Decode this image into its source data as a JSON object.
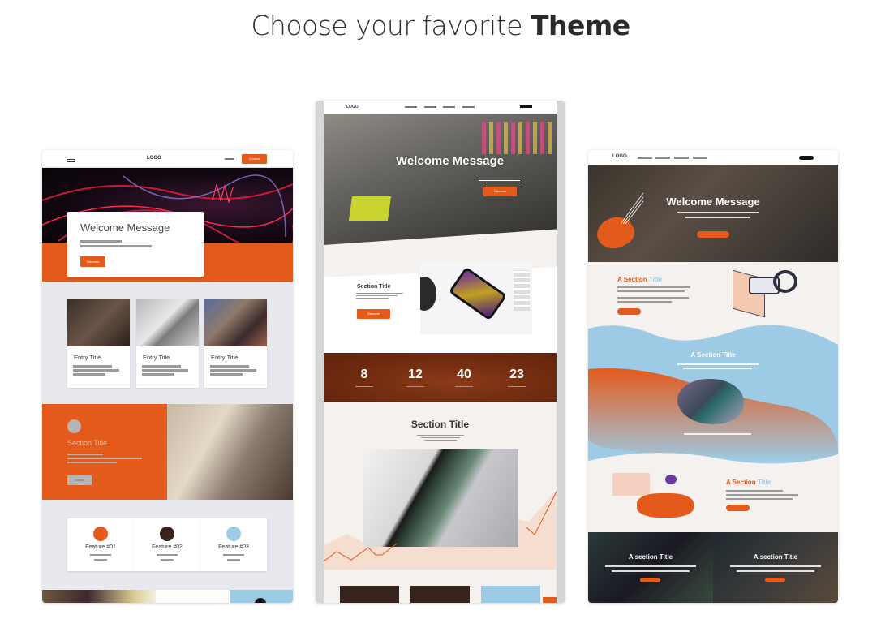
{
  "heading": {
    "prefix": "Choose your favorite ",
    "emphasis": "Theme"
  },
  "themes": [
    {
      "nav": {
        "logo": "LOGO",
        "cta": "Contact"
      },
      "hero": {
        "title": "Welcome Message",
        "button": "Discover"
      },
      "entries": [
        {
          "title": "Entry Title"
        },
        {
          "title": "Entry Title"
        },
        {
          "title": "Entry Title"
        }
      ],
      "section": {
        "title": "Section Title",
        "button": "Details"
      },
      "features": [
        {
          "label": "Feature #01",
          "color": "#e45a1b"
        },
        {
          "label": "Feature #02",
          "color": "#36231b"
        },
        {
          "label": "Feature #03",
          "color": "#9dcbe6"
        }
      ],
      "accent": "#e45a1b"
    },
    {
      "nav": {
        "logo": "LOGO"
      },
      "hero": {
        "title": "Welcome Message",
        "button": "Discover"
      },
      "section1": {
        "title": "Section Title",
        "button": "Discover"
      },
      "counters": [
        "8",
        "12",
        "40",
        "23"
      ],
      "section2": {
        "title": "Section Title"
      },
      "accent": "#e45a1b",
      "counter_bg": "#6e2a0f"
    },
    {
      "nav": {
        "logo": "LOGO"
      },
      "hero": {
        "title": "Welcome Message"
      },
      "section1": {
        "title_a": "A Section ",
        "title_b": "Title"
      },
      "section2": {
        "title": "A Section Title"
      },
      "section3": {
        "title_a": "A Section ",
        "title_b": "Title"
      },
      "tiles": [
        {
          "title": "A section Title"
        },
        {
          "title": "A section Title"
        }
      ],
      "accent": "#e45a1b",
      "wave": "#9dcbe6"
    }
  ]
}
